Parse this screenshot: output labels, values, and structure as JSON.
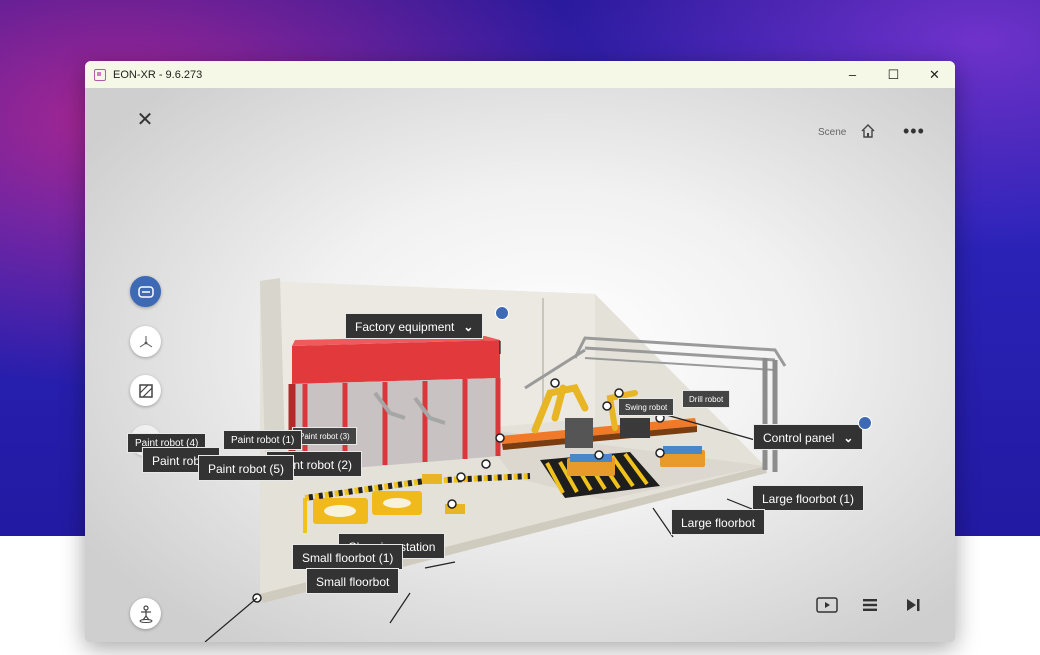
{
  "window": {
    "title": "EON-XR - 9.6.273",
    "minimize_glyph": "–",
    "maximize_glyph": "☐",
    "close_glyph": "✕"
  },
  "toolbar": {
    "close_glyph": "✕",
    "scene_label": "Scene",
    "home_icon": "home-icon",
    "more_glyph": "•••"
  },
  "side_tools": [
    {
      "icon": "annotation-icon",
      "active": true
    },
    {
      "icon": "move-axes-icon",
      "active": false
    },
    {
      "icon": "layers-icon",
      "active": false
    },
    {
      "icon": "camera-icon",
      "active": false
    }
  ],
  "labels": {
    "factory_equipment": "Factory equipment",
    "control_panel": "Control panel",
    "drill_robot": "Drill robot",
    "swing_robot": "Swing robot",
    "paint_robot_1": "Paint robot (1)",
    "paint_robot_2": "Paint robot (2)",
    "paint_robot_3": "Paint robot (3)",
    "paint_robot_4": "Paint robot (4)",
    "paint_robot_5": "Paint robot (5)",
    "paint_robot": "Paint robot",
    "large_floorbot_1": "Large floorbot (1)",
    "large_floorbot": "Large floorbot",
    "charging_station": "Charging station",
    "small_floorbot_1": "Small floorbot (1)",
    "small_floorbot": "Small floorbot"
  },
  "bottom_controls": {
    "play_icon": "play-icon",
    "list_icon": "list-icon",
    "next_icon": "skip-next-icon"
  },
  "colors": {
    "accent": "#3d69b5",
    "tag_bg": "#333333",
    "booth_red": "#d9373b",
    "robot_yellow": "#e8b525",
    "stripe_yellow": "#f2c21c"
  }
}
